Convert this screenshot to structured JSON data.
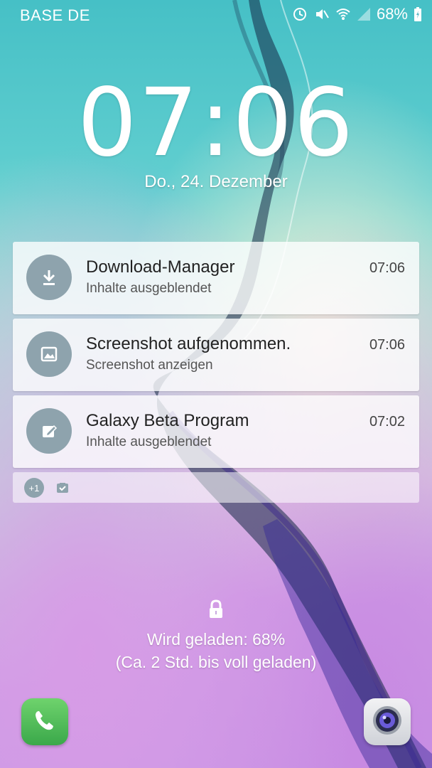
{
  "status_bar": {
    "carrier": "BASE DE",
    "battery_percent": "68%",
    "icons": [
      "alarm-sync-icon",
      "mute-icon",
      "wifi-icon",
      "signal-icon",
      "battery-charging-icon"
    ]
  },
  "lockscreen": {
    "clock_hours": "07",
    "clock_separator": ":",
    "clock_minutes": "06",
    "date": "Do., 24. Dezember"
  },
  "notifications": [
    {
      "icon": "download-icon",
      "title": "Download-Manager",
      "subtitle": "Inhalte ausgeblendet",
      "time": "07:06"
    },
    {
      "icon": "image-icon",
      "title": "Screenshot aufgenommen.",
      "subtitle": "Screenshot anzeigen",
      "time": "07:06"
    },
    {
      "icon": "edit-icon",
      "title": "Galaxy Beta Program",
      "subtitle": "Inhalte ausgeblendet",
      "time": "07:02"
    }
  ],
  "summary": {
    "more_count": "+1",
    "icon": "clipboard-check-icon"
  },
  "charging": {
    "line1": "Wird geladen: 68%",
    "line2": "(Ca. 2 Std. bis voll geladen)"
  },
  "shortcuts": {
    "left": "phone-icon",
    "right": "camera-icon"
  },
  "colors": {
    "notif_icon_bg": "#8ea3ad",
    "phone_green": "#4fbf55",
    "camera_lens": "#6a5bd8"
  }
}
